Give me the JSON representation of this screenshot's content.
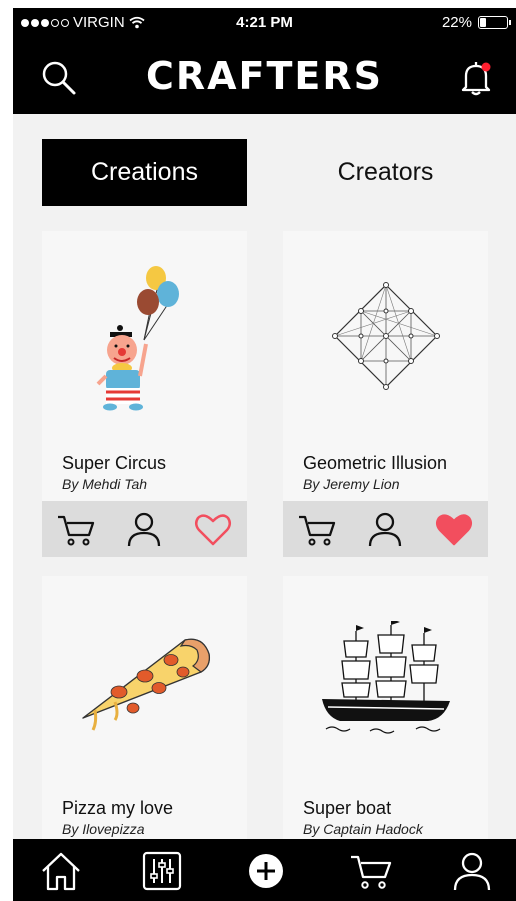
{
  "status": {
    "carrier": "VIRGIN",
    "time": "4:21 PM",
    "battery": "22%",
    "battery_level": 0.22
  },
  "header": {
    "logo": "CRAFTERS"
  },
  "tabs": [
    {
      "label": "Creations"
    },
    {
      "label": "Creators"
    }
  ],
  "cards": [
    {
      "title": "Super Circus",
      "author": "By Mehdi Tah",
      "liked": false
    },
    {
      "title": "Geometric Illusion",
      "author": "By Jeremy Lion",
      "liked": true
    },
    {
      "title": "Pizza my love",
      "author": "By Ilovepizza"
    },
    {
      "title": "Super boat",
      "author": "By Captain Hadock"
    }
  ],
  "colors": {
    "heart": "#f24e5e",
    "notification": "#ff1f2f",
    "dark": "#000000",
    "actions_bar": "#dcdcdc"
  },
  "icons": {
    "header": [
      "search-icon",
      "bell-icon"
    ],
    "card_actions": [
      "cart-icon",
      "user-icon",
      "heart-icon"
    ],
    "nav": [
      "home-icon",
      "sliders-icon",
      "plus-icon",
      "cart-icon",
      "user-icon"
    ]
  }
}
